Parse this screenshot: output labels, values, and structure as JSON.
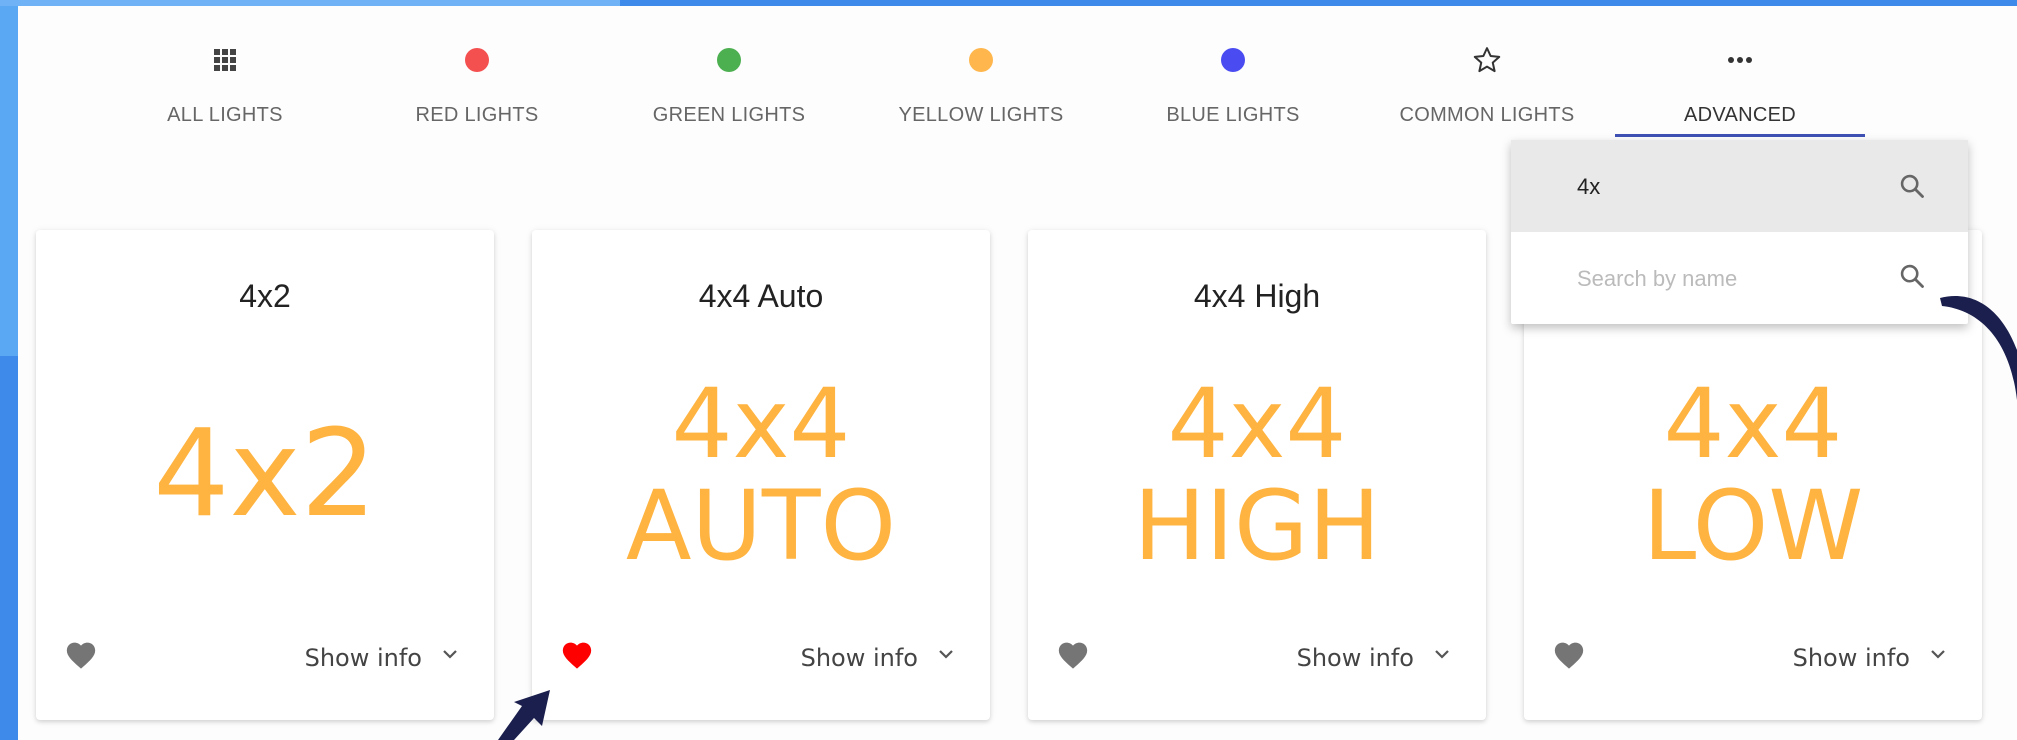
{
  "tabs": [
    {
      "label": "ALL LIGHTS",
      "icon": "grid-icon"
    },
    {
      "label": "RED LIGHTS",
      "icon": "red-dot-icon",
      "color": "#f45050"
    },
    {
      "label": "GREEN LIGHTS",
      "icon": "green-dot-icon",
      "color": "#4caf50"
    },
    {
      "label": "YELLOW LIGHTS",
      "icon": "yellow-dot-icon",
      "color": "#ffb74d"
    },
    {
      "label": "BLUE LIGHTS",
      "icon": "blue-dot-icon",
      "color": "#4a4cf2"
    },
    {
      "label": "COMMON LIGHTS",
      "icon": "star-icon"
    },
    {
      "label": "ADVANCED",
      "icon": "more-icon",
      "active": true
    }
  ],
  "search": {
    "value": "4x",
    "placeholder": "Search by name"
  },
  "cards": [
    {
      "title": "4x2",
      "image_line1": "4x2",
      "image_line2": "",
      "favorite": false,
      "show_info": "Show info"
    },
    {
      "title": "4x4 Auto",
      "image_line1": "4x4",
      "image_line2": "AUTO",
      "favorite": true,
      "show_info": "Show info"
    },
    {
      "title": "4x4 High",
      "image_line1": "4x4",
      "image_line2": "HIGH",
      "favorite": false,
      "show_info": "Show info"
    },
    {
      "title": "",
      "image_line1": "4x4",
      "image_line2": "LOW",
      "favorite": false,
      "show_info": "Show info"
    }
  ],
  "colors": {
    "accent": "#3f51b5",
    "image_text": "#ffb340",
    "heart_active": "#ff0000",
    "heart_inactive": "#757575",
    "frame": "#2f80e6"
  }
}
